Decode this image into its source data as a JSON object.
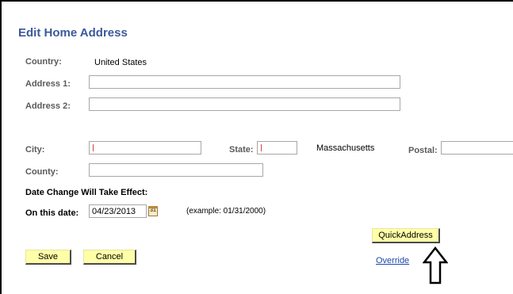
{
  "page": {
    "title": "Edit Home Address"
  },
  "form": {
    "country_label": "Country:",
    "country_value": "United States",
    "address1_label": "Address 1:",
    "address1_value": "",
    "address2_label": "Address 2:",
    "address2_value": "",
    "city_label": "City:",
    "city_value": "",
    "state_label": "State:",
    "state_value": "",
    "state_name": "Massachusetts",
    "postal_label": "Postal:",
    "postal_value": "",
    "county_label": "County:",
    "county_value": "",
    "effective_heading": "Date Change Will Take Effect:",
    "date_label": "On this date:",
    "date_value": "04/23/2013",
    "calendar_icon_text": "31",
    "date_example": "(example: 01/31/2000)"
  },
  "buttons": {
    "quick_address_label": "QuickAddress",
    "save_label": "Save",
    "cancel_label": "Cancel",
    "override_label": "Override"
  },
  "icons": {
    "calendar": "calendar-icon",
    "annotation_arrow": "up-arrow-icon"
  }
}
